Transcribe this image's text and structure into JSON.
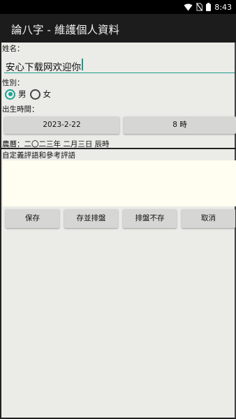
{
  "status_bar": {
    "time": "8:43",
    "icons": [
      "wifi-icon",
      "no-sim-icon",
      "battery-icon"
    ]
  },
  "app_bar": {
    "title": "論八字 - 維護個人資料"
  },
  "form": {
    "name_label": "姓名：",
    "name_value": "安心下载网欢迎你",
    "gender_label": "性別：",
    "gender_options": [
      {
        "label": "男",
        "checked": true
      },
      {
        "label": "女",
        "checked": false
      }
    ],
    "birth_label": "出生時間：",
    "date_button": "2023-2-22",
    "hour_button": "8 時",
    "lunar_text": "農曆：二〇二三年 二月三日 辰時",
    "comment_label": "自定義評語和參考評語",
    "comment_value": ""
  },
  "actions": {
    "save": "保存",
    "save_and_chart": "存並排盤",
    "chart_no_save": "排盤不存",
    "cancel": "取消"
  },
  "colors": {
    "accent": "#1aa596",
    "app_bar": "#1c1c1c",
    "status_bar": "#000000",
    "comment_bg": "#fffef0"
  }
}
